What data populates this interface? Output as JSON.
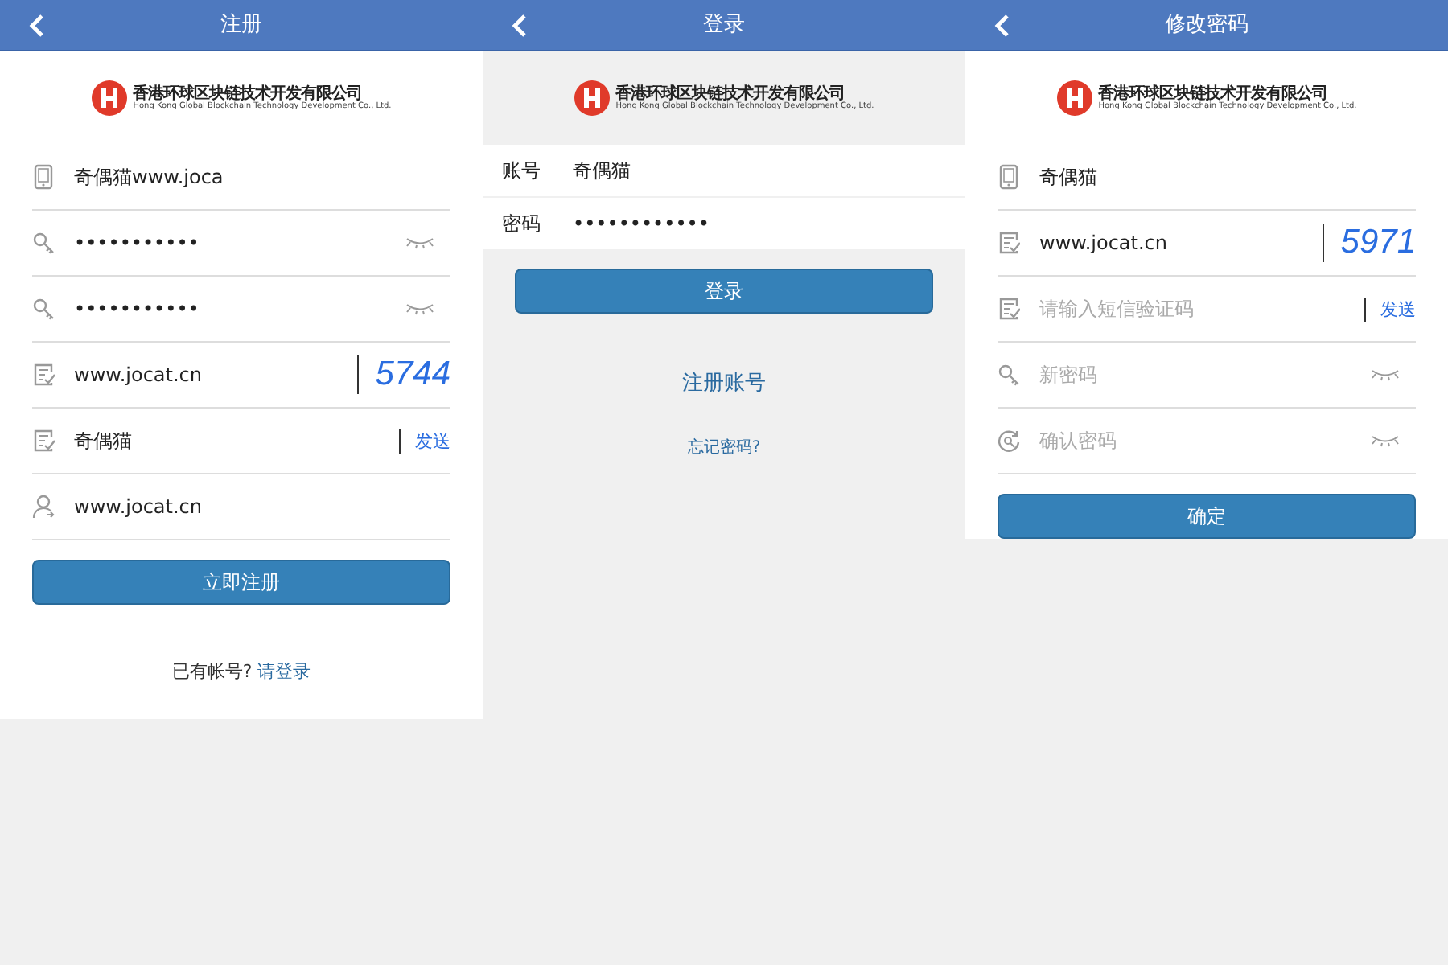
{
  "screens": [
    {
      "kind": "register",
      "title": "注册",
      "logo": {
        "name_zh": "香港环球区块链技术开发有限公司",
        "name_en": "Hong Kong Global Blockchain Technology Development Co., Ltd."
      },
      "fields": [
        {
          "kind": "phone",
          "value": "奇偶猫www.joca"
        },
        {
          "kind": "password",
          "value": "•••••••••••"
        },
        {
          "kind": "password",
          "value": "•••••••••••"
        },
        {
          "kind": "captcha",
          "value": "www.jocat.cn",
          "captcha": "5744"
        },
        {
          "kind": "sms",
          "value": "奇偶猫",
          "action": "发送"
        },
        {
          "kind": "user",
          "value": "www.jocat.cn"
        }
      ],
      "button": "立即注册",
      "footer_text": "已有帐号?",
      "footer_link": "请登录"
    },
    {
      "kind": "login",
      "title": "登录",
      "logo": {
        "name_zh": "香港环球区块链技术开发有限公司",
        "name_en": "Hong Kong Global Blockchain Technology Development Co., Ltd."
      },
      "fields": [
        {
          "kind": "labeled",
          "label": "账号",
          "value": "奇偶猫"
        },
        {
          "kind": "labeled",
          "label": "密码",
          "value": "••••••••••••"
        }
      ],
      "button": "登录",
      "links": [
        "注册账号",
        "忘记密码?"
      ]
    },
    {
      "kind": "reset",
      "title": "修改密码",
      "logo": {
        "name_zh": "香港环球区块链技术开发有限公司",
        "name_en": "Hong Kong Global Blockchain Technology Development Co., Ltd."
      },
      "fields": [
        {
          "kind": "phone",
          "value": "奇偶猫"
        },
        {
          "kind": "captcha",
          "value": "www.jocat.cn",
          "captcha": "5971"
        },
        {
          "kind": "sms",
          "placeholder": "请输入短信验证码",
          "action": "发送"
        },
        {
          "kind": "password",
          "placeholder": "新密码"
        },
        {
          "kind": "confirm",
          "placeholder": "确认密码"
        }
      ],
      "button": "确定"
    }
  ]
}
